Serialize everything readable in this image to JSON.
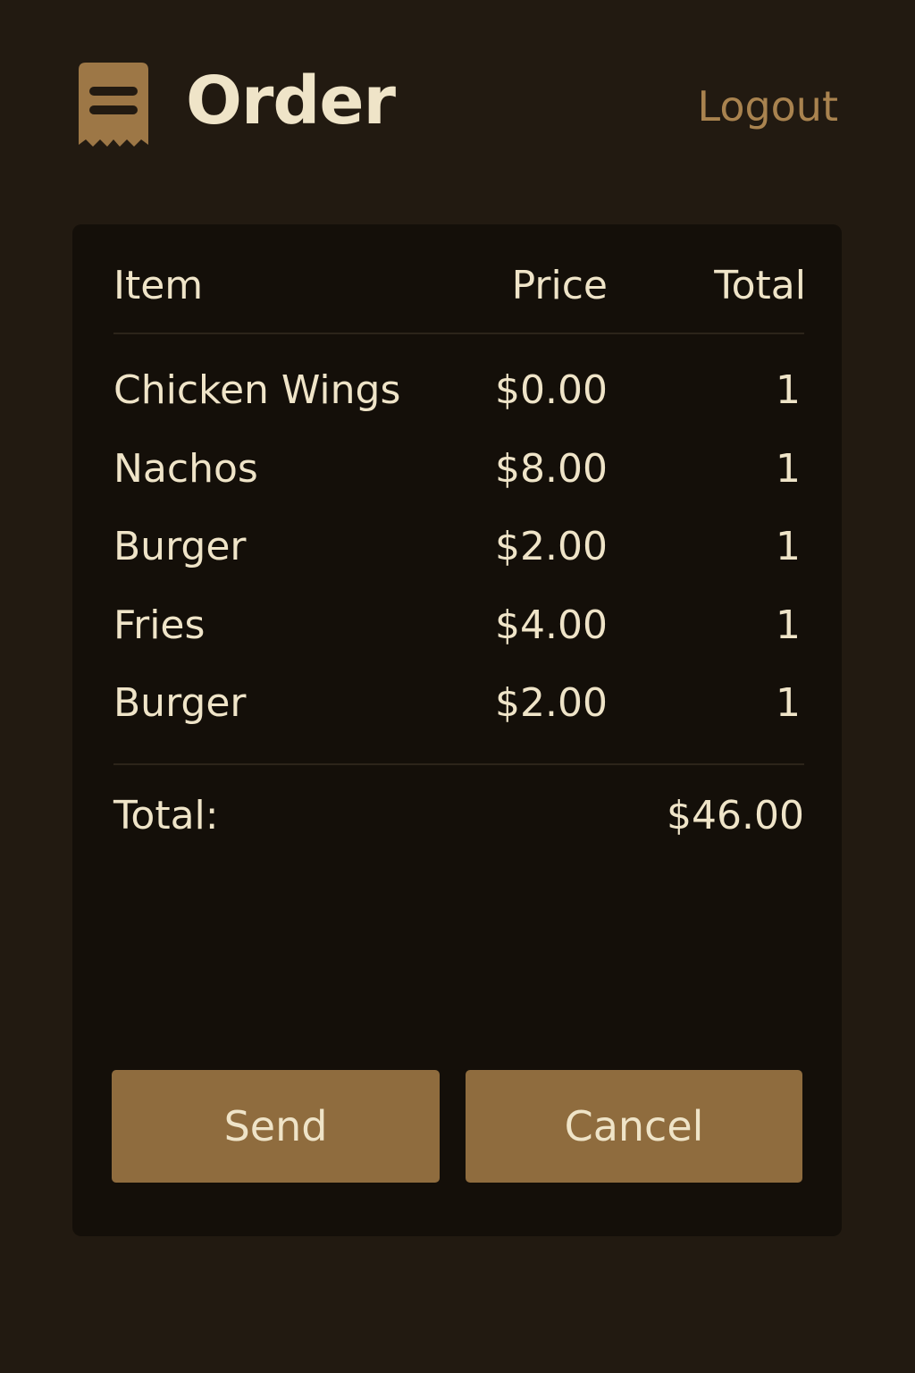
{
  "header": {
    "title": "Order",
    "logout_label": "Logout",
    "logo_icon": "receipt-icon"
  },
  "table": {
    "columns": [
      "Item",
      "Price",
      "Total"
    ],
    "rows": [
      {
        "item": "Chicken Wings",
        "price": "$0.00",
        "qty": "1"
      },
      {
        "item": "Nachos",
        "price": "$8.00",
        "qty": "1"
      },
      {
        "item": "Burger",
        "price": "$2.00",
        "qty": "1"
      },
      {
        "item": "Fries",
        "price": "$4.00",
        "qty": "1"
      },
      {
        "item": "Burger",
        "price": "$2.00",
        "qty": "1"
      }
    ],
    "total_label": "Total:",
    "total_value": "$46.00"
  },
  "actions": {
    "send_label": "Send",
    "cancel_label": "Cancel"
  },
  "colors": {
    "background": "#221a11",
    "card": "#140f09",
    "accent": "#8f6c3e",
    "text": "#efe4c8",
    "link": "#a9834f"
  }
}
